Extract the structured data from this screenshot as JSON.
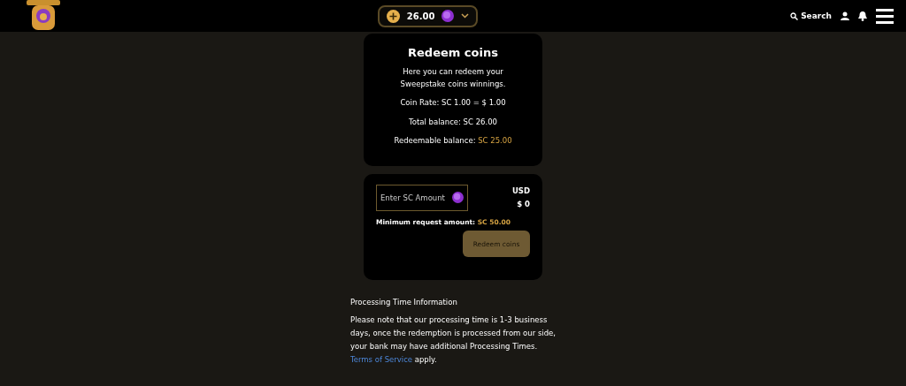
{
  "header": {
    "balance": "26.00",
    "search_label": "Search"
  },
  "redeem_card": {
    "title": "Redeem coins",
    "description": "Here you can redeem your Sweepstake coins winnings.",
    "coin_rate": "Coin Rate: SC 1.00 = $ 1.00",
    "total_balance": "Total balance: SC 26.00",
    "redeemable_label": "Redeemable balance:",
    "redeemable_value": "SC 25.00"
  },
  "amount_card": {
    "placeholder": "Enter SC Amount",
    "currency": "USD",
    "converted": "$ 0",
    "minimum_label": "Minimum request amount:",
    "minimum_value": "SC 50.00",
    "button": {
      "label": "Redeem coins",
      "disabled": true
    }
  },
  "info": {
    "heading": "Processing Time Information",
    "text_before": "Please note that our processing time is 1-3 business days, once the redemption is processed from our side, your bank may have additional Processing Times.",
    "link": "Terms of Service",
    "text_after": "apply."
  }
}
